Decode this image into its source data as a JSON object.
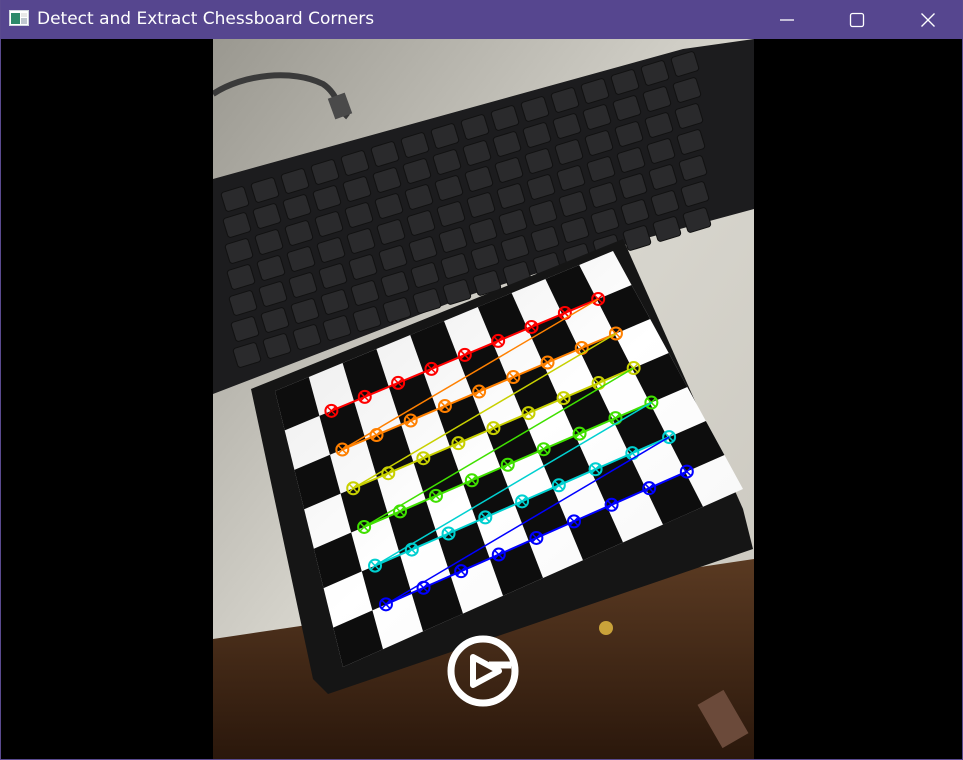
{
  "window": {
    "title": "Detect and Extract Chessboard Corners",
    "controls": {
      "minimize_icon": "minimize-icon",
      "maximize_icon": "maximize-icon",
      "close_icon": "close-icon"
    }
  },
  "colors": {
    "titlebar": "#56468f",
    "title_text": "#ffffff",
    "background": "#000000",
    "corner_row_colors": [
      "#ff0000",
      "#ff8000",
      "#c8d000",
      "#40e000",
      "#00d0d0",
      "#0000ff"
    ]
  },
  "overlay": {
    "logo_icon": "playback-logo-icon"
  }
}
